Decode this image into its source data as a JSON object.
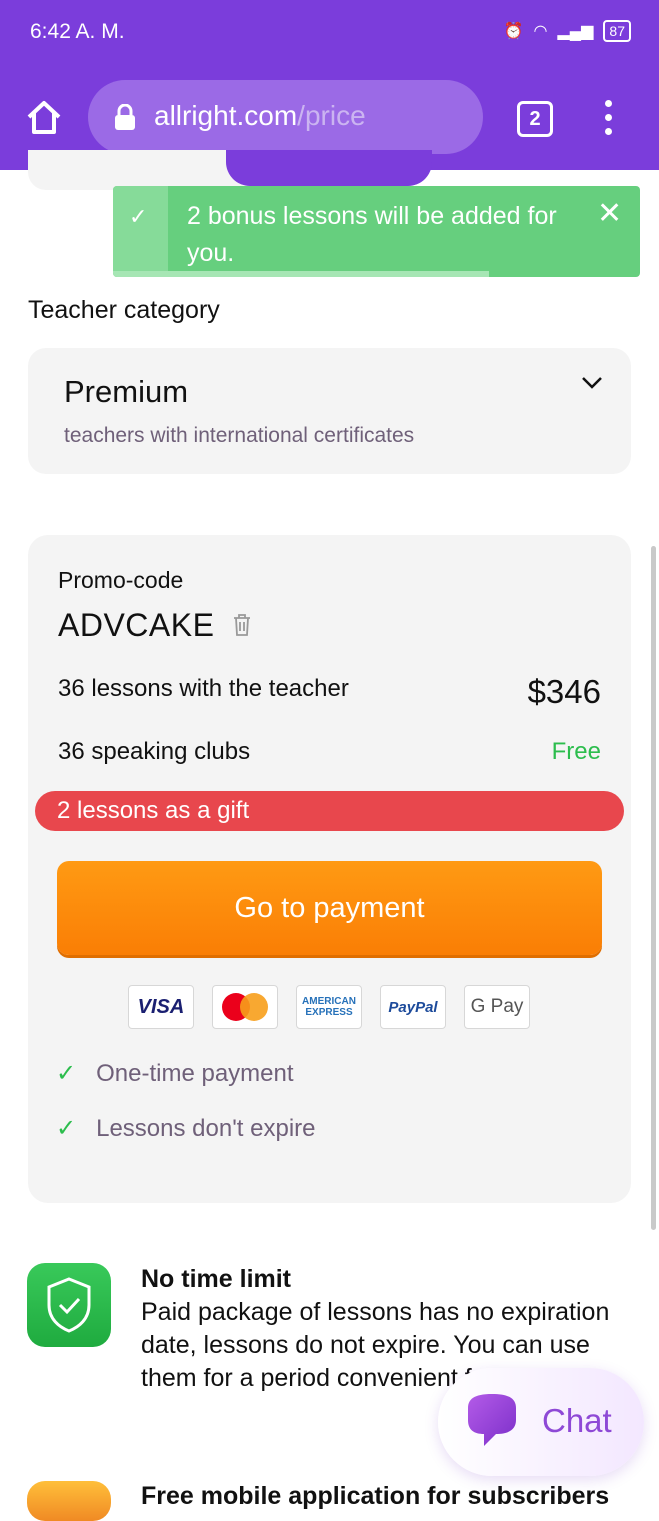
{
  "status_bar": {
    "time": "6:42 A. M.",
    "battery": "87"
  },
  "browser": {
    "domain": "allright.com",
    "path": "/price",
    "tab_count": "2"
  },
  "toast": {
    "message": "2 bonus lessons will be added for you.",
    "close": "✕"
  },
  "teacher_category": {
    "label": "Teacher category",
    "selected_title": "Premium",
    "selected_subtitle": "teachers with international certificates"
  },
  "order": {
    "promo_label": "Promo-code",
    "promo_code": "ADVCAKE",
    "lessons_label": "36 lessons with the teacher",
    "lessons_price": "$346",
    "clubs_label": "36 speaking clubs",
    "clubs_price": "Free",
    "gift_label": "2 lessons as a gift",
    "pay_button": "Go to payment",
    "payment_methods": [
      "VISA",
      "Mastercard",
      "AMERICAN EXPRESS",
      "PayPal",
      "G Pay"
    ],
    "features": [
      "One-time payment",
      "Lessons don't expire"
    ]
  },
  "benefits": [
    {
      "title": "No time limit",
      "text": "Paid package of lessons has no expiration date, lessons do not expire. You can use them for a period convenient for you.",
      "icon": "shield-check-icon"
    },
    {
      "title": "Free mobile application for subscribers",
      "icon": "app-icon"
    }
  ],
  "chat": {
    "label": "Chat"
  },
  "colors": {
    "brand": "#7b3ddb",
    "toast": "#66cf7e",
    "pay": "#fa8a0a",
    "gift": "#e8474d",
    "free": "#2cbd4d"
  }
}
